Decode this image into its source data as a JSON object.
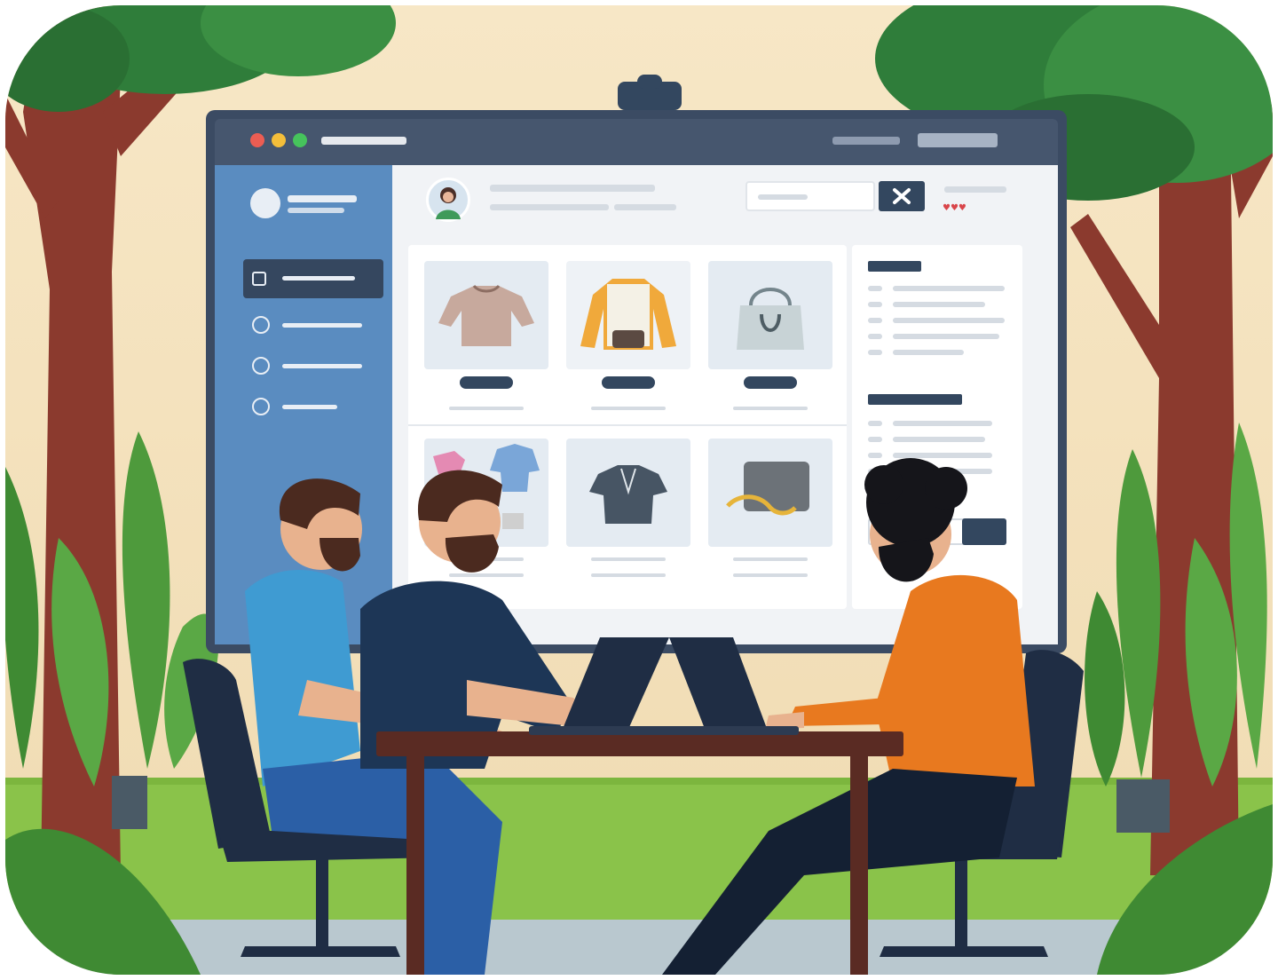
{
  "colors": {
    "wall": "#f4e3c0",
    "screen_frame": "#3b4b63",
    "sidebar": "#5a8cc0",
    "sidebar_active": "#35475f",
    "content_bg": "#f1f3f6",
    "window_red": "#ec5d53",
    "window_yellow": "#f4be3a",
    "window_green": "#46c35c",
    "accent_dark": "#33475f",
    "shirt_blue": "#3f9bd2",
    "shirt_navy": "#1d3656",
    "sweater_orange": "#e8791f",
    "plant_green": "#4e9a3c"
  },
  "icons": {
    "search": "close-x-icon",
    "hearts": "hearts-icon",
    "webcam": "webcam-icon",
    "avatar": "avatar-icon"
  }
}
